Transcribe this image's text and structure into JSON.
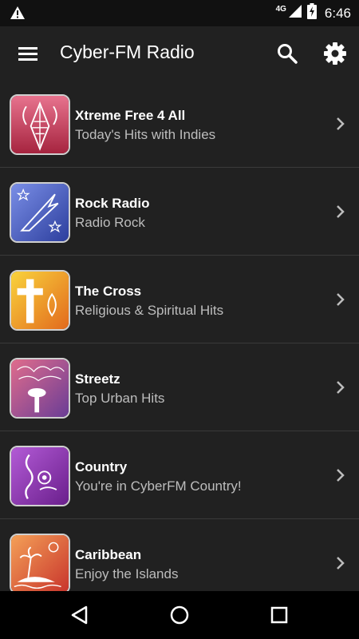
{
  "status_bar": {
    "network": "4G",
    "time": "6:46",
    "icons": [
      "warning-icon",
      "signal-icon",
      "battery-charging-icon"
    ]
  },
  "app_bar": {
    "title": "Cyber-FM Radio",
    "icons": [
      "menu-icon",
      "search-icon",
      "settings-icon"
    ]
  },
  "stations": [
    {
      "title": "Xtreme Free 4 All",
      "subtitle": "Today's Hits with Indies",
      "color": "#c6385c"
    },
    {
      "title": "Rock Radio",
      "subtitle": "Radio Rock",
      "color": "#3e58c7"
    },
    {
      "title": "The Cross",
      "subtitle": "Religious & Spiritual Hits",
      "color": "#f0a41a"
    },
    {
      "title": "Streetz",
      "subtitle": "Top Urban Hits",
      "color": "#b8406d"
    },
    {
      "title": "Country",
      "subtitle": "You're in CyberFM Country!",
      "color": "#8a2fb0"
    },
    {
      "title": "Caribbean",
      "subtitle": "Enjoy the Islands",
      "color": "#e86a3c"
    }
  ],
  "nav_bar": {
    "icons": [
      "back-icon",
      "home-icon",
      "recents-icon"
    ]
  },
  "colors": {
    "background": "#212121",
    "status_bar": "#111111",
    "nav_bar": "#000000",
    "subtitle_text": "#bdbdbd",
    "divider": "#3a3a3a"
  }
}
